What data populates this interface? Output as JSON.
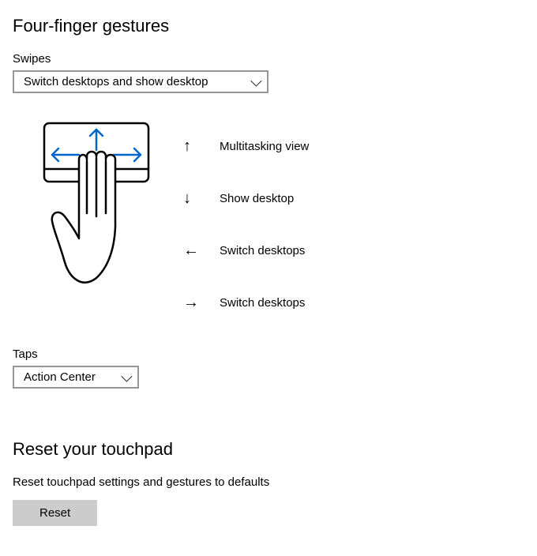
{
  "section_gestures": {
    "title": "Four-finger gestures",
    "swipes_label": "Swipes",
    "swipes_value": "Switch desktops and show desktop",
    "directions": [
      {
        "glyph": "↑",
        "label": "Multitasking view"
      },
      {
        "glyph": "↓",
        "label": "Show desktop"
      },
      {
        "glyph": "←",
        "label": "Switch desktops"
      },
      {
        "glyph": "→",
        "label": "Switch desktops"
      }
    ],
    "taps_label": "Taps",
    "taps_value": "Action Center"
  },
  "section_reset": {
    "title": "Reset your touchpad",
    "description": "Reset touchpad settings and gestures to defaults",
    "button": "Reset"
  }
}
